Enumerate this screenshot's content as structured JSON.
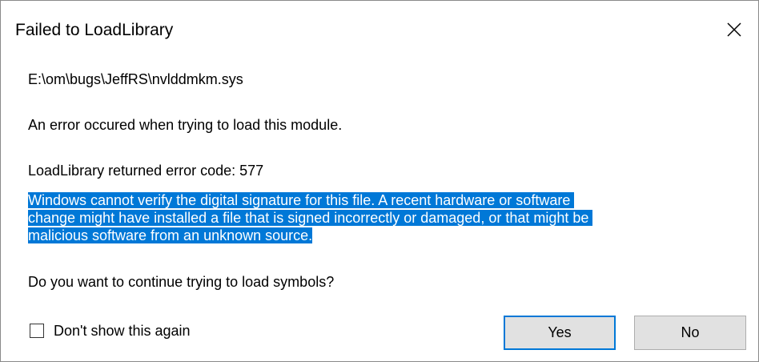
{
  "window": {
    "title": "Failed to LoadLibrary",
    "close_icon": "close-icon"
  },
  "message": {
    "file_path": "E:\\om\\bugs\\JeffRS\\nvlddmkm.sys",
    "error_text": "An error occured when trying to load this module.",
    "error_code_text": "LoadLibrary returned error code: 577",
    "detail_lines": [
      "Windows cannot verify the digital signature for this file. A recent hardware or software ",
      "change might have installed a file that is signed incorrectly or damaged, or that might be ",
      "malicious software from an unknown source."
    ],
    "question": "Do you want to continue trying to load symbols?"
  },
  "options": {
    "dont_show_label": "Don't show this again",
    "dont_show_checked": false
  },
  "buttons": {
    "yes_label": "Yes",
    "no_label": "No"
  },
  "colors": {
    "selection": "#0078d7",
    "button_face": "#e1e1e1",
    "default_button_border": "#0078d7"
  }
}
